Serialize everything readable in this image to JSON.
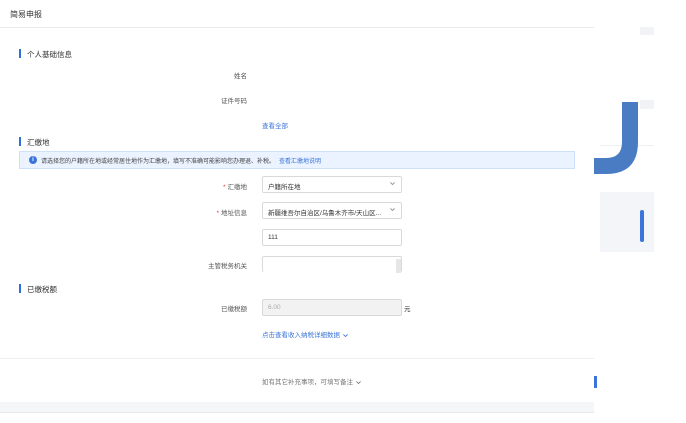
{
  "header": {
    "title": "简易申报"
  },
  "sections": {
    "personal": {
      "title": "个人基础信息",
      "name_label": "姓名",
      "id_label": "证件号码",
      "view_all": "查看全部"
    },
    "payment_location": {
      "title": "汇缴地",
      "notice_text": "请选择您的户籍所在地或经常居住地作为汇缴地，填写不准确可能影响您办理退、补税。",
      "notice_link": "查看汇缴地说明",
      "location_label": "汇缴地",
      "location_value": "户籍所在地",
      "address_label": "地址信息",
      "address_value": "新疆维吾尔自治区/乌鲁木齐市/天山区...",
      "detail_value": "111",
      "tax_office_label": "主管税务机关"
    },
    "paid_tax": {
      "title": "已缴税额",
      "amount_label": "已缴税额",
      "amount_value": "6.00",
      "unit": "元",
      "detail_link": "点击查看收入纳税详细数据"
    }
  },
  "footer": {
    "note": "如有其它补充事项，可填写备注"
  },
  "colors": {
    "accent": "#3b74d9",
    "required": "#e53e3e",
    "notice_bg": "#eaf3ff",
    "decor": "#4a7cc4"
  },
  "icons": {
    "notice": "info-icon",
    "chevron": "chevron-down-icon"
  }
}
